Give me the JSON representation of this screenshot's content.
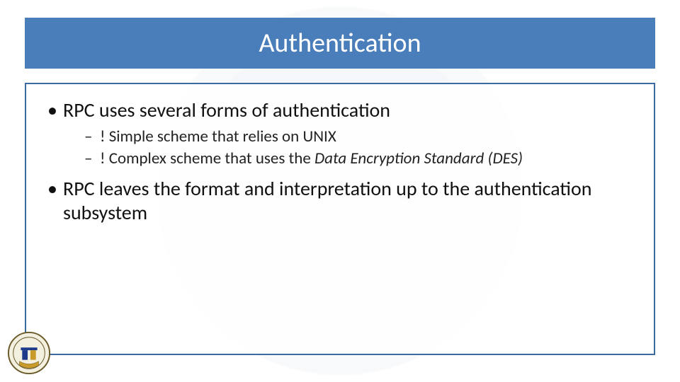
{
  "slide": {
    "title": "Authentication",
    "bullets": [
      {
        "text": "RPC uses several forms of authentication",
        "sub": [
          {
            "text": "! Simple scheme that relies on UNIX"
          },
          {
            "prefix": "! Complex scheme that uses the ",
            "italic": "Data Encryption Standard (DES)"
          }
        ]
      },
      {
        "text": "RPC leaves the format and interpretation up to the authentication subsystem"
      }
    ]
  },
  "logo": {
    "name": "university-seal"
  }
}
